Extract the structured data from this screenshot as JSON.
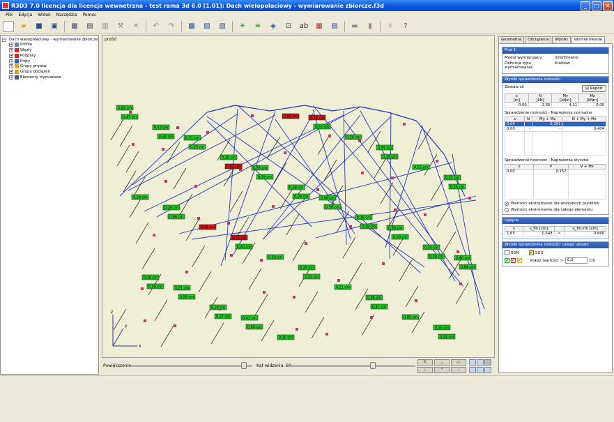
{
  "window": {
    "title": "R3D3 7.0 licencja dla licencja wewnetrzna - test rama 3d 6.0 [1.01]: Dach wielopołaciowy - wymiarowanie zbiorcze.f3d"
  },
  "menu": [
    "Plik",
    "Edycja",
    "Widok",
    "Narzędzia",
    "Pomoc"
  ],
  "tree": {
    "root": "Dach wielopołaciowy - wymiarowanie zbiorcze",
    "children": [
      "Profile",
      "Węzły",
      "Podpory",
      "Pręty",
      "Grupy prętów",
      "Grupy obciążeń",
      "Elementy wymiarowe"
    ]
  },
  "viewport": {
    "label": "przód",
    "axes": {
      "x": "x",
      "y": "y",
      "z": "z"
    },
    "zoom_label": "Powiększenie",
    "angle_label": "Kąt widzenia: 60",
    "deflection_labels": [
      {
        "t": "0,61 cm",
        "c": "g"
      },
      {
        "t": "0,31 cm",
        "c": "g"
      },
      {
        "t": "0,65 cm",
        "c": "g"
      },
      {
        "t": "0,56 cm",
        "c": "g"
      },
      {
        "t": "0,50 cm",
        "c": "g"
      },
      {
        "t": "0,40 cm",
        "c": "g"
      },
      {
        "t": "0,21 cm",
        "c": "g"
      },
      {
        "t": "0,41 cm",
        "c": "g"
      },
      {
        "t": "0,38 cm",
        "c": "r"
      },
      {
        "t": "0,59 cm",
        "c": "g"
      },
      {
        "t": "0,47 cm",
        "c": "g"
      },
      {
        "t": "0,26 cm",
        "c": "g"
      },
      {
        "t": "0,31 cm",
        "c": "r"
      },
      {
        "t": "0,25 cm",
        "c": "g"
      },
      {
        "t": "0,86 cm",
        "c": "g"
      },
      {
        "t": "0,35 cm",
        "c": "g"
      },
      {
        "t": "0,43 cm",
        "c": "g"
      },
      {
        "t": "0,26 cm",
        "c": "g"
      },
      {
        "t": "0,38 cm",
        "c": "g"
      },
      {
        "t": "0,26 cm",
        "c": "g"
      },
      {
        "t": "0,25 cm",
        "c": "g"
      },
      {
        "t": "0,28 cm",
        "c": "g"
      },
      {
        "t": "0,28 cm",
        "c": "g"
      },
      {
        "t": "0,30 cm",
        "c": "g"
      },
      {
        "t": "0,28 cm",
        "c": "g"
      },
      {
        "t": "0,52 cm",
        "c": "g"
      },
      {
        "t": "0,29 cm",
        "c": "g"
      },
      {
        "t": "0,45 cm",
        "c": "r"
      },
      {
        "t": "0,29 cm",
        "c": "g"
      },
      {
        "t": "0,21 cm",
        "c": "g"
      },
      {
        "t": "0,85 cm",
        "c": "g"
      },
      {
        "t": "0,47 cm",
        "c": "g"
      },
      {
        "t": "0,25 cm",
        "c": "g"
      },
      {
        "t": "0,29 cm",
        "c": "g"
      },
      {
        "t": "0,58 cm",
        "c": "g"
      },
      {
        "t": "0,28 cm",
        "c": "g"
      },
      {
        "t": "0,84 cm",
        "c": "g"
      },
      {
        "t": "0,58 cm",
        "c": "g"
      },
      {
        "t": "0,60 cm",
        "c": "g"
      },
      {
        "t": "0,55 cm",
        "c": "g"
      },
      {
        "t": "0,29 cm",
        "c": "g"
      },
      {
        "t": "0,26 cm",
        "c": "g"
      },
      {
        "t": "0,66 cm",
        "c": "g"
      },
      {
        "t": "0,60 cm",
        "c": "g"
      },
      {
        "t": "0,31 cm",
        "c": "g"
      },
      {
        "t": "0,41 cm",
        "c": "g"
      },
      {
        "t": "0,34 cm",
        "c": "g"
      },
      {
        "t": "0,24 cm",
        "c": "g"
      },
      {
        "t": "0,61 cm",
        "c": "r"
      },
      {
        "t": "0,38 cm",
        "c": "g"
      },
      {
        "t": "0,29 cm",
        "c": "g"
      },
      {
        "t": "0,28 cm",
        "c": "g"
      },
      {
        "t": "0,36 cm",
        "c": "g"
      },
      {
        "t": "0,27 cm",
        "c": "g"
      },
      {
        "t": "0,66 cm",
        "c": "r"
      }
    ]
  },
  "tabs": [
    "Geometria",
    "Obciążenia",
    "Wyniki",
    "Wymiarowanie"
  ],
  "bar": {
    "title": "Pręt 1",
    "module_label": "Moduł wymiarujący:",
    "module_value": "InterDrewno",
    "def_label": "Definicja typu wymiarowania:",
    "def_value": "Krokiew"
  },
  "capacity": {
    "title": "Wyniki sprawdzenia nośności",
    "forces_label": "Zestaw sił",
    "report_btn": "Raport",
    "forces_headers": [
      "x\n[m]",
      "N\n[kN]",
      "My\n[kNm]",
      "Mz\n[kNm]"
    ],
    "forces_row": [
      "0,00",
      "2,35",
      "4,11",
      "0,00"
    ],
    "normal_title": "Sprawdzenie nośności - Naprężenia normalne",
    "normal_headers": [
      "x",
      "N",
      "My + Mz",
      "N + My + Mz"
    ],
    "normal_rows": [
      [
        "0,00",
        "-",
        "0,391",
        "-"
      ],
      [
        "0,00",
        "-",
        "-",
        "0,404"
      ]
    ],
    "shear_title": "Sprawdzenie nośności - Naprężenia styczne",
    "shear_headers": [
      "x",
      "V",
      "V + Mx"
    ],
    "shear_rows": [
      [
        "0,00",
        "0,257",
        "-"
      ]
    ],
    "radio1": "Wartości ekstremalne dla wszystkich punktów",
    "radio2": "Wartości ekstremalne dla całego elementu"
  },
  "deflection": {
    "title": "Ugięcie",
    "headers": [
      "x",
      "u_fin [cm]",
      "",
      "u_fin,lim [cm]"
    ],
    "row": [
      "1,65",
      "0,548",
      "<",
      "0,660"
    ]
  },
  "system": {
    "title": "Wyniki sprawdzenia nośności całego układu",
    "sgn": "SGN",
    "sgu": "SGU",
    "show_label": "Pokaż wartości >",
    "show_value": "0,2",
    "unit": "cm"
  },
  "colors": {
    "ok": "#22cc22",
    "fail": "#dd1111",
    "structure": "#2233cc",
    "hatch": "#000000"
  }
}
